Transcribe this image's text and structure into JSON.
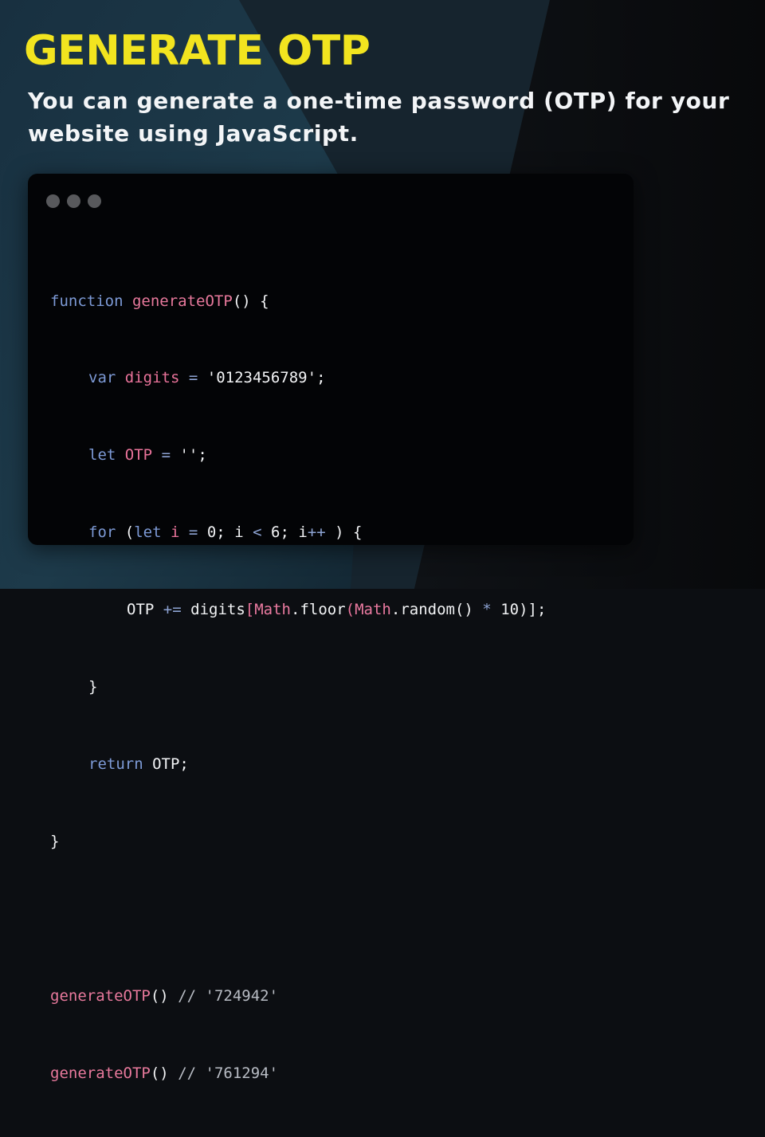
{
  "heading": {
    "title": "GENERATE OTP",
    "subtitle": "You can generate a one-time password (OTP) for your website using JavaScript."
  },
  "colors": {
    "title": "#f2e41f",
    "subtitle": "#f3f5f7",
    "background_dark": "#0c0e12",
    "background_teal": "#1f3a49",
    "code_background": "#030406",
    "window_dot": "#58595c",
    "keyword": "#7d9ad6",
    "function_name": "#e8799c",
    "operator": "#8ea4d4"
  },
  "code": {
    "window_dots_count": 3,
    "tokens": {
      "kw_function": "function",
      "fn_name": "generateOTP",
      "paren_open_brace": "() {",
      "kw_var": "var",
      "id_digits": "digits",
      "op_assign": "=",
      "str_digits": "'0123456789'",
      "semicolon": ";",
      "kw_let": "let",
      "id_otp": "OTP",
      "str_empty": "''",
      "kw_for": "for",
      "paren_open": "(",
      "id_i": "i",
      "num_zero": "0",
      "op_lt": "<",
      "num_six": "6",
      "op_inc": "++",
      "paren_close_brace": ") {",
      "op_plus_assign": "+=",
      "bracket_open": "[",
      "id_math": "Math",
      "dot": ".",
      "id_floor": "floor",
      "id_random": "random",
      "parens_empty": "()",
      "op_mul": "*",
      "num_ten": "10",
      "close_call": ")];",
      "brace_close": "}",
      "kw_return": "return",
      "call_parens": "()",
      "comment_1": "// '724942'",
      "comment_2": "// '761294'"
    }
  }
}
